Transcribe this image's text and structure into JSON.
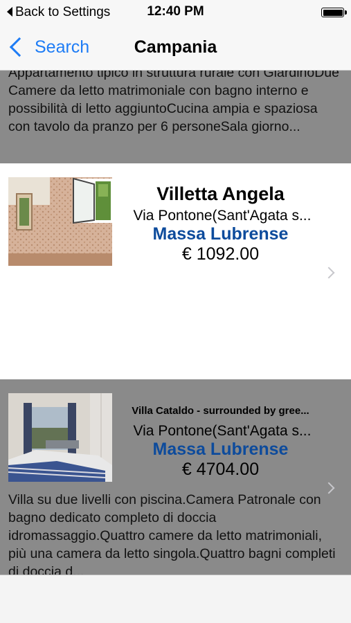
{
  "status_bar": {
    "back_label": "Back to Settings",
    "time": "12:40 PM"
  },
  "nav": {
    "back_label": "Search",
    "title": "Campania"
  },
  "listings": [
    {
      "description": "Appartamento tipico in struttura rurale con GiardinoDue Camere da letto matrimoniale con bagno interno e possibilità di letto aggiuntoCucina ampia e spaziosa con tavolo da pranzo per 6 personeSala giorno..."
    },
    {
      "title": "Villetta Angela",
      "address": "Via Pontone(Sant'Agata s...",
      "city": "Massa Lubrense",
      "price": "€ 1092.00"
    },
    {
      "title": "Villa Cataldo - surrounded by gree...",
      "address": "Via Pontone(Sant'Agata s...",
      "city": "Massa Lubrense",
      "price": "€ 4704.00",
      "description": "Villa su due livelli con piscina.Camera Patronale con bagno dedicato completo di doccia idromassaggio.Quattro camere da letto matrimoniali, più una camera da letto singola.Quattro bagni completi di doccia d..."
    }
  ],
  "colors": {
    "ios_blue": "#1e7cf5",
    "city_blue": "#0d4b9c",
    "highlight_gray": "#8a8a8a"
  }
}
